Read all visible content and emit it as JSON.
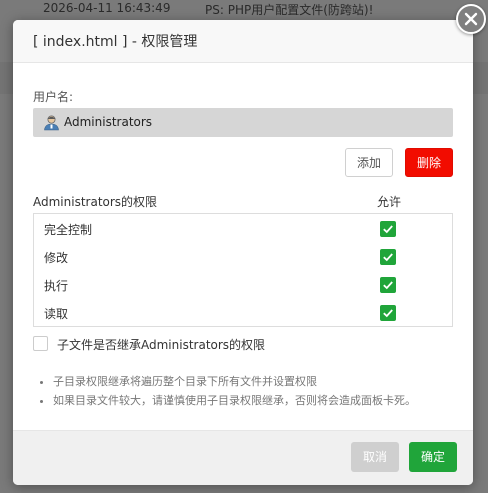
{
  "background": {
    "log_time": "2026-04-11 16:43:49",
    "log_message": "PS: PHP用户配置文件(防跨站)!"
  },
  "dialog": {
    "title": "[ index.html ] - 权限管理",
    "close_icon": "close-icon",
    "username_label": "用户名:",
    "username_value": "Administrators",
    "user_icon": "user-avatar-icon",
    "add_label": "添加",
    "delete_label": "删除",
    "permissions_header": "Administrators的权限",
    "allow_header": "允许",
    "permissions": [
      {
        "name": "完全控制",
        "allowed": true
      },
      {
        "name": "修改",
        "allowed": true
      },
      {
        "name": "执行",
        "allowed": true
      },
      {
        "name": "读取",
        "allowed": true
      }
    ],
    "inherit_label": "子文件是否继承Administrators的权限",
    "inherit_checked": false,
    "notes": [
      "子目录权限继承将遍历整个目录下所有文件并设置权限",
      "如果目录文件较大，请谨慎使用子目录权限继承，否则将会造成面板卡死。"
    ],
    "cancel_label": "取消",
    "confirm_label": "确定"
  },
  "colors": {
    "accent_green": "#20a53a",
    "danger_red": "#f20c00",
    "disabled_gray": "#cfcfcf"
  }
}
